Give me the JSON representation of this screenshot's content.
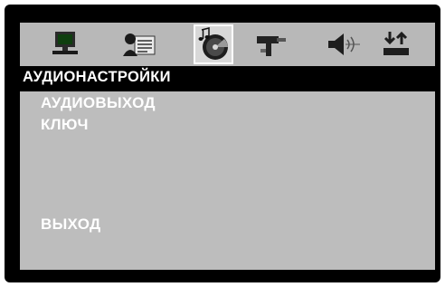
{
  "toolbar": {
    "tabs": [
      {
        "icon": "monitor-icon",
        "active": false
      },
      {
        "icon": "language-icon",
        "active": false
      },
      {
        "icon": "audio-disc-icon",
        "active": true
      },
      {
        "icon": "tools-icon",
        "active": false
      },
      {
        "icon": "speaker-icon",
        "active": false
      },
      {
        "icon": "input-output-icon",
        "active": false
      }
    ]
  },
  "section": {
    "title": "АУДИОНАСТРОЙКИ"
  },
  "menu": {
    "items": [
      "АУДИОВЫХОД",
      "КЛЮЧ"
    ],
    "exit": "ВЫХОД"
  },
  "colors": {
    "frame": "#000000",
    "panel": "#bdbdbd",
    "toolbar": "#b8b8b8",
    "text": "#ffffff"
  }
}
